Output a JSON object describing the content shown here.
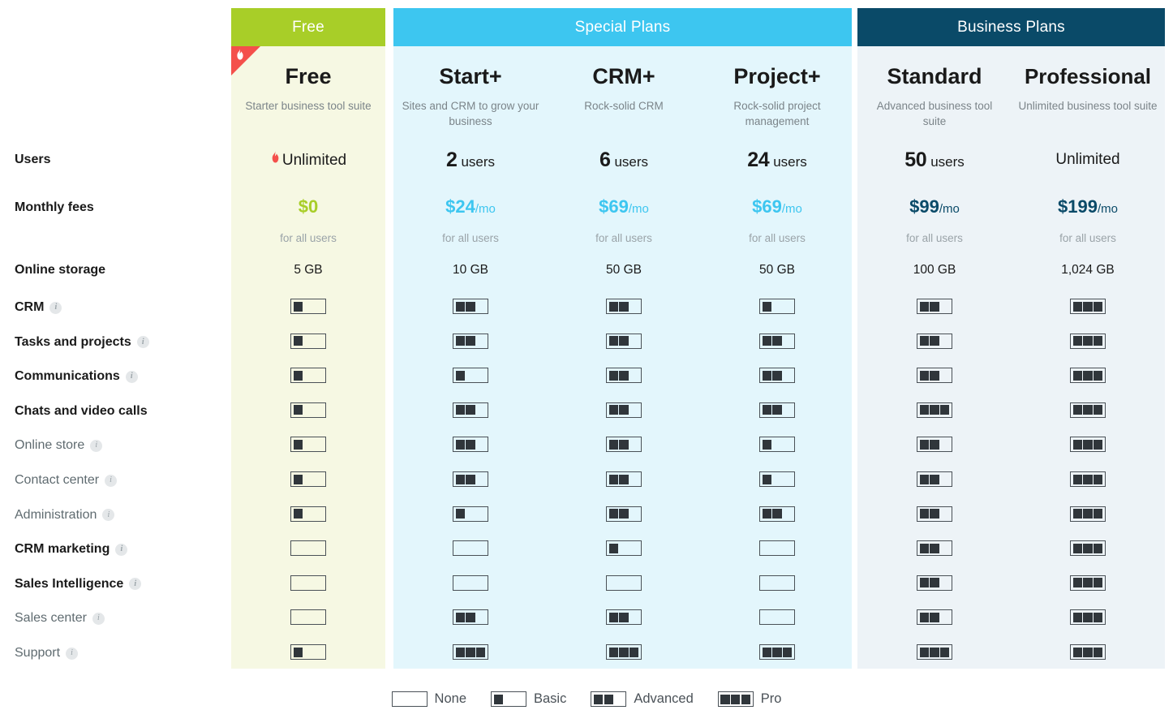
{
  "groups": [
    {
      "id": "free",
      "label": "Free",
      "color": "#A8CE28"
    },
    {
      "id": "special",
      "label": "Special Plans",
      "color": "#3DC6F0"
    },
    {
      "id": "business",
      "label": "Business Plans",
      "color": "#0A4A68"
    }
  ],
  "ribbon": {
    "icon": "flame-icon",
    "glyph": "●"
  },
  "plans": [
    {
      "name": "Free",
      "description": "Starter business tool suite",
      "users": "Unlimited",
      "users_prefix_icon": "flame-icon",
      "users_suffix": "",
      "price_amount": "$0",
      "price_per": "",
      "price_note": "for all users",
      "storage": "5 GB"
    },
    {
      "name": "Start+",
      "description": "Sites and CRM to grow your business",
      "users": "2",
      "users_prefix_icon": "",
      "users_suffix": "users",
      "price_amount": "$24",
      "price_per": "/mo",
      "price_note": "for all users",
      "storage": "10 GB"
    },
    {
      "name": "CRM+",
      "description": "Rock-solid CRM",
      "users": "6",
      "users_prefix_icon": "",
      "users_suffix": "users",
      "price_amount": "$69",
      "price_per": "/mo",
      "price_note": "for all users",
      "storage": "50 GB"
    },
    {
      "name": "Project+",
      "description": "Rock-solid project management",
      "users": "24",
      "users_prefix_icon": "",
      "users_suffix": "users",
      "price_amount": "$69",
      "price_per": "/mo",
      "price_note": "for all users",
      "storage": "50 GB"
    },
    {
      "name": "Standard",
      "description": "Advanced business tool suite",
      "users": "50",
      "users_prefix_icon": "",
      "users_suffix": "users",
      "price_amount": "$99",
      "price_per": "/mo",
      "price_note": "for all users",
      "storage": "100 GB"
    },
    {
      "name": "Professional",
      "description": "Unlimited business tool suite",
      "users": "Unlimited",
      "users_prefix_icon": "",
      "users_suffix": "",
      "price_amount": "$199",
      "price_per": "/mo",
      "price_note": "for all users",
      "storage": "1,024 GB"
    }
  ],
  "row_labels": {
    "users": "Users",
    "monthly_fees": "Monthly fees",
    "online_storage": "Online storage"
  },
  "features": [
    {
      "label": "CRM",
      "bold": true,
      "info": true,
      "levels": [
        1,
        2,
        2,
        1,
        2,
        3
      ]
    },
    {
      "label": "Tasks and projects",
      "bold": true,
      "info": true,
      "levels": [
        1,
        2,
        2,
        2,
        2,
        3
      ]
    },
    {
      "label": "Communications",
      "bold": true,
      "info": true,
      "levels": [
        1,
        1,
        2,
        2,
        2,
        3
      ]
    },
    {
      "label": "Chats and video calls",
      "bold": true,
      "info": false,
      "levels": [
        1,
        2,
        2,
        2,
        3,
        3
      ]
    },
    {
      "label": "Online store",
      "bold": false,
      "info": true,
      "levels": [
        1,
        2,
        2,
        1,
        2,
        3
      ]
    },
    {
      "label": "Contact center",
      "bold": false,
      "info": true,
      "levels": [
        1,
        2,
        2,
        1,
        2,
        3
      ]
    },
    {
      "label": "Administration",
      "bold": false,
      "info": true,
      "levels": [
        1,
        1,
        2,
        2,
        2,
        3
      ]
    },
    {
      "label": "CRM marketing",
      "bold": true,
      "info": true,
      "levels": [
        0,
        0,
        1,
        0,
        2,
        3
      ]
    },
    {
      "label": "Sales Intelligence",
      "bold": true,
      "info": true,
      "levels": [
        0,
        0,
        0,
        0,
        2,
        3
      ]
    },
    {
      "label": "Sales center",
      "bold": false,
      "info": true,
      "levels": [
        0,
        2,
        2,
        0,
        2,
        3
      ]
    },
    {
      "label": "Support",
      "bold": false,
      "info": true,
      "levels": [
        1,
        3,
        3,
        3,
        3,
        3
      ]
    }
  ],
  "legend": [
    {
      "label": "None",
      "level": 0
    },
    {
      "label": "Basic",
      "level": 1
    },
    {
      "label": "Advanced",
      "level": 2
    },
    {
      "label": "Pro",
      "level": 3
    }
  ],
  "info_icon_glyph": "i"
}
